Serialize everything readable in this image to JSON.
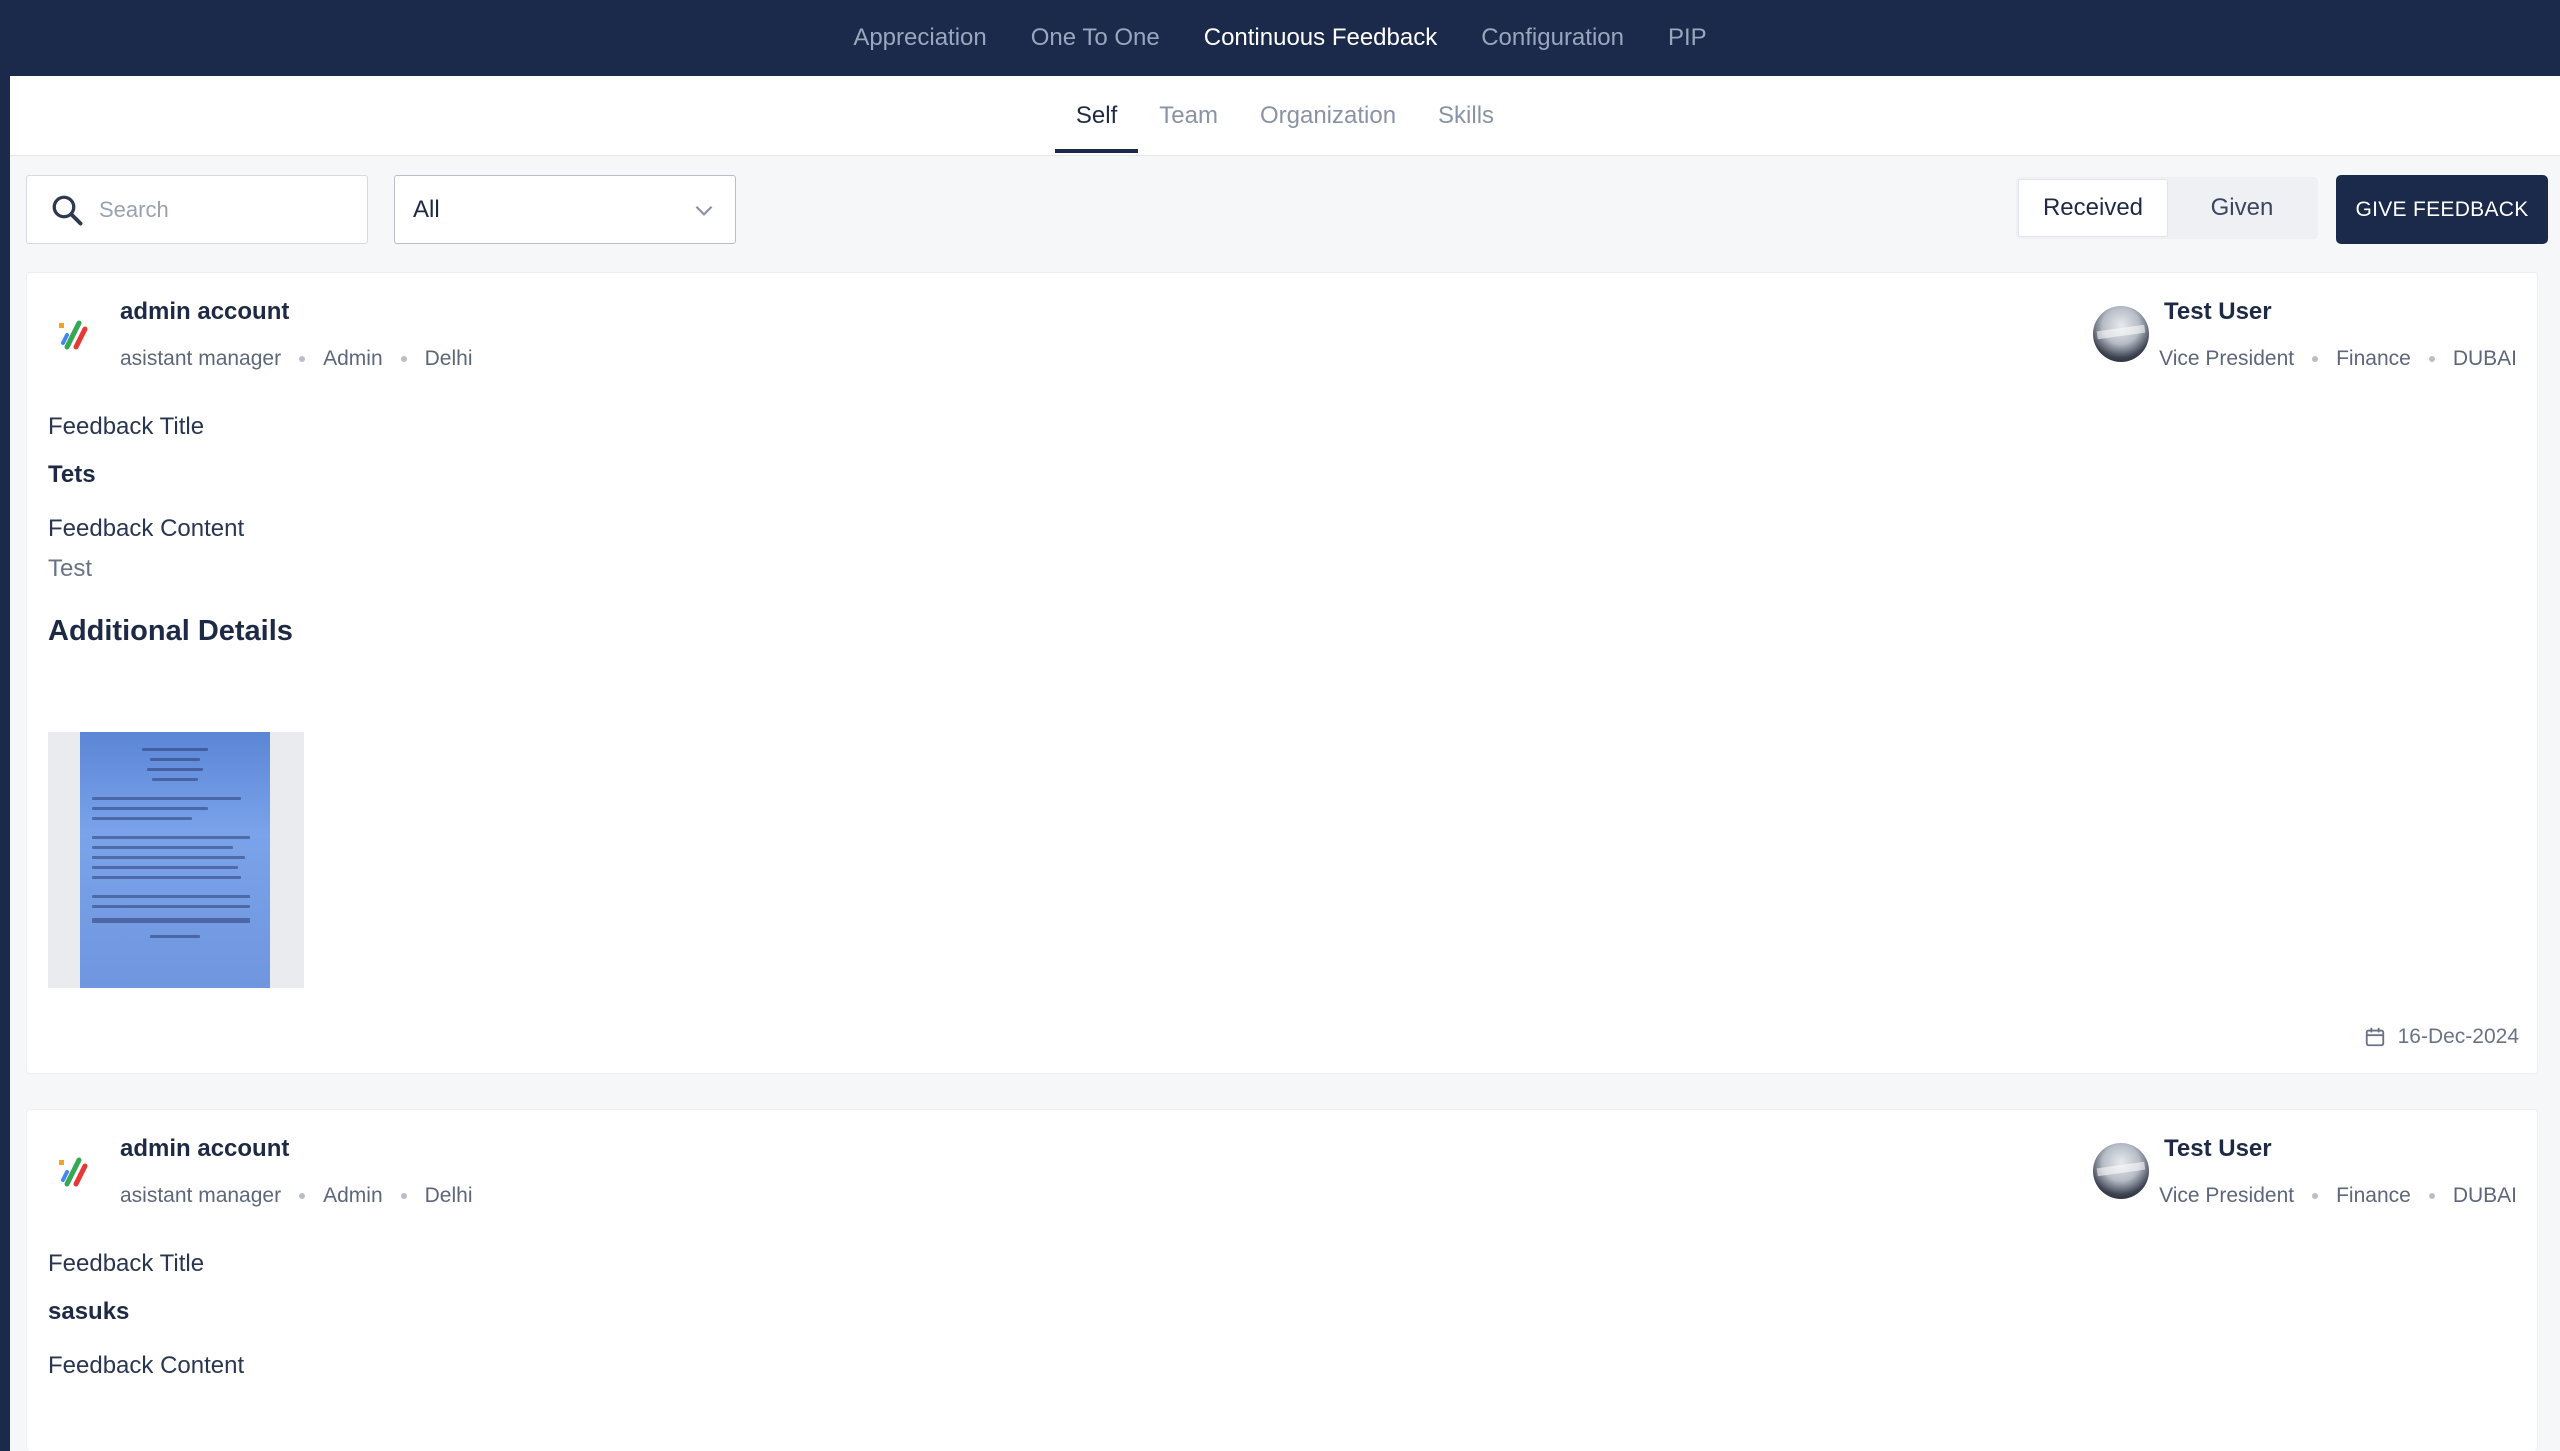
{
  "topnav": {
    "items": [
      {
        "label": "Appreciation",
        "active": false
      },
      {
        "label": "One To One",
        "active": false
      },
      {
        "label": "Continuous Feedback",
        "active": true
      },
      {
        "label": "Configuration",
        "active": false
      },
      {
        "label": "PIP",
        "active": false
      }
    ]
  },
  "subtabs": {
    "items": [
      {
        "label": "Self",
        "active": true
      },
      {
        "label": "Team",
        "active": false
      },
      {
        "label": "Organization",
        "active": false
      },
      {
        "label": "Skills",
        "active": false
      }
    ]
  },
  "toolbar": {
    "search_placeholder": "Search",
    "filter_value": "All",
    "toggle_received": "Received",
    "toggle_given": "Given",
    "toggle_active": "Received",
    "give_feedback_label": "GIVE FEEDBACK"
  },
  "feedback": [
    {
      "giver": {
        "name": "admin account",
        "designation": "asistant manager",
        "role": "Admin",
        "location": "Delhi"
      },
      "receiver": {
        "name": "Test User",
        "designation": "Vice President",
        "department": "Finance",
        "location": "DUBAI"
      },
      "title_label": "Feedback Title",
      "title": "Tets",
      "content_label": "Feedback Content",
      "content": "Test",
      "additional_heading": "Additional Details",
      "date": "16-Dec-2024"
    },
    {
      "giver": {
        "name": "admin account",
        "designation": "asistant manager",
        "role": "Admin",
        "location": "Delhi"
      },
      "receiver": {
        "name": "Test User",
        "designation": "Vice President",
        "department": "Finance",
        "location": "DUBAI"
      },
      "title_label": "Feedback Title",
      "title": "sasuks",
      "content_label": "Feedback Content"
    }
  ],
  "colors": {
    "nav_bg": "#1b2a4a",
    "page_bg": "#f6f7f9",
    "primary_button": "#1b2a4a"
  }
}
